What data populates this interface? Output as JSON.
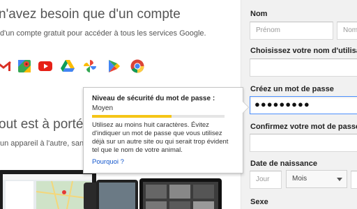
{
  "promo": {
    "headline": "n'avez besoin que d'un compte",
    "subline": "d'un compte gratuit pour accéder à tous les services Google.",
    "headline2": "out est à portée",
    "subline2": "un appareil à l'autre, sans"
  },
  "services_icons": [
    "gmail-icon",
    "maps-icon",
    "youtube-icon",
    "drive-icon",
    "photos-icon",
    "play-store-icon",
    "chrome-icon"
  ],
  "form": {
    "name_label": "Nom",
    "first_name_placeholder": "Prénom",
    "last_name_placeholder": "Nom",
    "username_label": "Choisissez votre nom d'utilisate",
    "password_label": "Créez un mot de passe",
    "password_value": "●●●●●●●●●",
    "confirm_label": "Confirmez votre mot de passe",
    "birthdate_label": "Date de naissance",
    "day_placeholder": "Jour",
    "month_value": "Mois",
    "gender_label": "Sexe"
  },
  "tooltip": {
    "title": "Niveau de sécurité du mot de passe :",
    "strength": "Moyen",
    "strength_level": 0.6,
    "body": "Utilisez au moins huit caractères. Évitez d'indiquer un mot de passe que vous utilisez déjà sur un autre site ou qui serait trop évident tel que le nom de votre animal.",
    "link": "Pourquoi ?"
  },
  "colors": {
    "focus_border": "#4d90fe",
    "strength_fill": "#f5c518",
    "link": "#1155cc"
  }
}
